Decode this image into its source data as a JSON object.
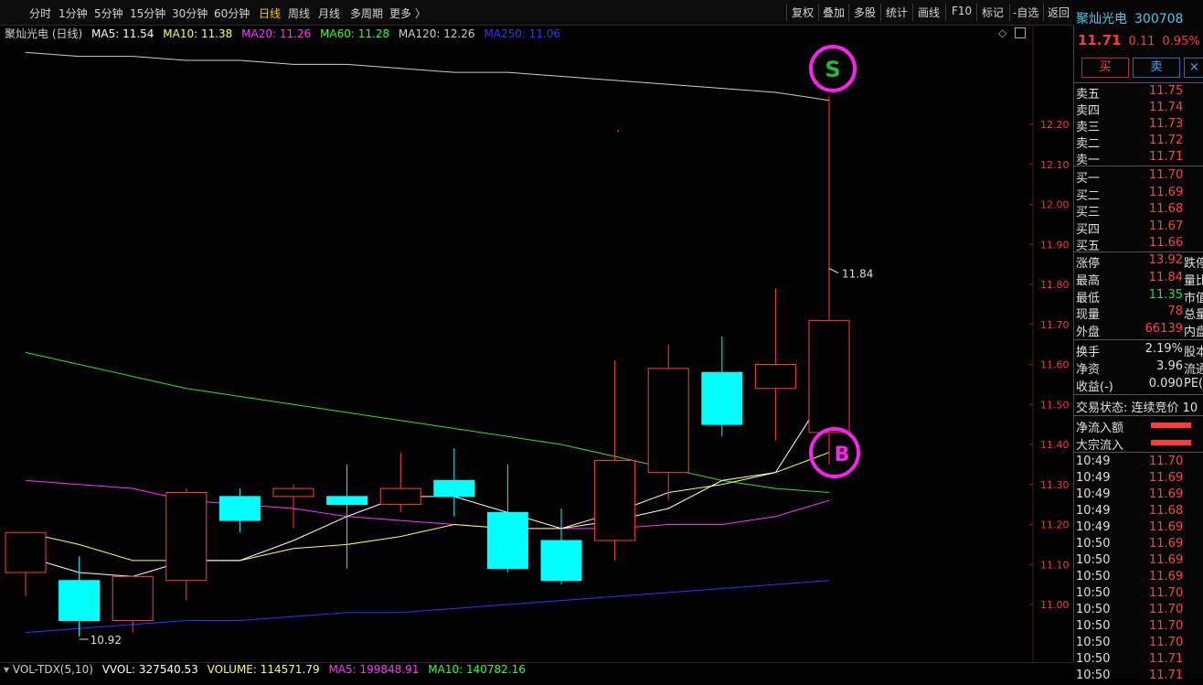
{
  "toolbar": {
    "periods": [
      "分时",
      "1分钟",
      "5分钟",
      "15分钟",
      "30分钟",
      "60分钟",
      "日线",
      "周线",
      "月线",
      "多周期",
      "更多 〉"
    ],
    "active_period": "日线",
    "right_buttons": [
      "复权",
      "叠加",
      "多股",
      "统计",
      "画线",
      "F10",
      "标记",
      "-自选",
      "返回"
    ]
  },
  "legend": {
    "title": "聚灿光电 (日线)",
    "items": [
      {
        "text": "MA5: 11.54",
        "color": "#ffffff"
      },
      {
        "text": "MA10: 11.38",
        "color": "#ffff55"
      },
      {
        "text": "MA20: 11.26",
        "color": "#ff33ff"
      },
      {
        "text": "MA60: 11.28",
        "color": "#33ff33"
      },
      {
        "text": "MA120: 12.26",
        "color": "#d0d0d0"
      },
      {
        "text": "MA250: 11.06",
        "color": "#3333ff"
      }
    ]
  },
  "chart_data": {
    "type": "candlestick",
    "y_ticks": [
      "12.20",
      "12.10",
      "12.00",
      "11.90",
      "11.80",
      "11.70",
      "11.60",
      "11.50",
      "11.40",
      "11.30",
      "11.20",
      "11.10",
      "11.00"
    ],
    "ylim": [
      10.9,
      12.3
    ],
    "candles": [
      {
        "o": 11.08,
        "c": 11.18,
        "h": 11.18,
        "l": 11.02
      },
      {
        "o": 11.06,
        "c": 10.96,
        "h": 11.12,
        "l": 10.92
      },
      {
        "o": 10.96,
        "c": 11.07,
        "h": 11.07,
        "l": 10.93
      },
      {
        "o": 11.06,
        "c": 11.28,
        "h": 11.29,
        "l": 11.01
      },
      {
        "o": 11.27,
        "c": 11.21,
        "h": 11.29,
        "l": 11.18
      },
      {
        "o": 11.27,
        "c": 11.29,
        "h": 11.3,
        "l": 11.19
      },
      {
        "o": 11.27,
        "c": 11.25,
        "h": 11.35,
        "l": 11.09
      },
      {
        "o": 11.25,
        "c": 11.29,
        "h": 11.38,
        "l": 11.23
      },
      {
        "o": 11.31,
        "c": 11.27,
        "h": 11.39,
        "l": 11.22
      },
      {
        "o": 11.23,
        "c": 11.09,
        "h": 11.35,
        "l": 11.08
      },
      {
        "o": 11.16,
        "c": 11.06,
        "h": 11.24,
        "l": 11.05
      },
      {
        "o": 11.16,
        "c": 11.36,
        "h": 11.61,
        "l": 11.11
      },
      {
        "o": 11.33,
        "c": 11.59,
        "h": 11.65,
        "l": 11.26
      },
      {
        "o": 11.58,
        "c": 11.45,
        "h": 11.67,
        "l": 11.42
      },
      {
        "o": 11.54,
        "c": 11.6,
        "h": 11.79,
        "l": 11.41
      },
      {
        "o": 11.43,
        "c": 11.71,
        "h": 12.27,
        "l": 11.35
      }
    ],
    "ma5": [
      11.12,
      11.08,
      11.07,
      11.11,
      11.11,
      11.16,
      11.22,
      11.27,
      11.27,
      11.23,
      11.19,
      11.21,
      11.24,
      11.31,
      11.33,
      11.54
    ],
    "ma10": [
      11.18,
      11.15,
      11.11,
      11.11,
      11.11,
      11.14,
      11.15,
      11.17,
      11.2,
      11.19,
      11.19,
      11.23,
      11.28,
      11.3,
      11.33,
      11.38
    ],
    "ma20": [
      11.31,
      11.3,
      11.29,
      11.26,
      11.25,
      11.24,
      11.22,
      11.21,
      11.2,
      11.19,
      11.19,
      11.19,
      11.2,
      11.2,
      11.22,
      11.26
    ],
    "ma60": [
      11.63,
      11.6,
      11.57,
      11.54,
      11.52,
      11.5,
      11.48,
      11.46,
      11.44,
      11.42,
      11.4,
      11.37,
      11.34,
      11.31,
      11.29,
      11.28
    ],
    "ma120": [
      12.38,
      12.37,
      12.37,
      12.36,
      12.36,
      12.35,
      12.35,
      12.34,
      12.33,
      12.33,
      12.32,
      12.31,
      12.3,
      12.29,
      12.28,
      12.26
    ],
    "ma250": [
      10.93,
      10.94,
      10.95,
      10.96,
      10.96,
      10.97,
      10.98,
      10.98,
      10.99,
      11.0,
      11.01,
      11.02,
      11.03,
      11.04,
      11.05,
      11.06
    ],
    "annotations": {
      "high_label": "11.84",
      "low_label": "10.92",
      "sell_marker": "S",
      "buy_marker": "B"
    }
  },
  "volume_bar": {
    "title": "VOL-TDX(5,10)",
    "items": [
      {
        "text": "VVOL: 327540.53",
        "color": "#ffffff"
      },
      {
        "text": "VOLUME: 114571.79",
        "color": "#ffff55"
      },
      {
        "text": "MA5: 199848.91",
        "color": "#ff33ff"
      },
      {
        "text": "MA10: 140782.16",
        "color": "#33ff33"
      }
    ]
  },
  "stock": {
    "name": "聚灿光电",
    "code": "300708",
    "price": "11.71",
    "change": "0.11",
    "pct": "0.95%"
  },
  "trade_buttons": {
    "buy": "买",
    "sell": "卖"
  },
  "asks": [
    {
      "label": "卖五",
      "price": "11.75"
    },
    {
      "label": "卖四",
      "price": "11.74"
    },
    {
      "label": "卖三",
      "price": "11.73"
    },
    {
      "label": "卖二",
      "price": "11.72"
    },
    {
      "label": "卖一",
      "price": "11.71"
    }
  ],
  "bids": [
    {
      "label": "买一",
      "price": "11.70"
    },
    {
      "label": "买二",
      "price": "11.69"
    },
    {
      "label": "买三",
      "price": "11.68"
    },
    {
      "label": "买四",
      "price": "11.67"
    },
    {
      "label": "买五",
      "price": "11.66"
    }
  ],
  "stats": [
    {
      "label": "涨停",
      "value": "13.92",
      "value_color": "#ff4444",
      "extra": "跌停"
    },
    {
      "label": "最高",
      "value": "11.84",
      "value_color": "#ff4444",
      "extra": "量比"
    },
    {
      "label": "最低",
      "value": "11.35",
      "value_color": "#33dd33",
      "extra": "市值"
    },
    {
      "label": "现量",
      "value": "78",
      "value_color": "#ff4444",
      "extra": "总量"
    },
    {
      "label": "外盘",
      "value": "66139",
      "value_color": "#ff4444",
      "extra": "内盘"
    }
  ],
  "stats2": [
    {
      "label": "换手",
      "value": "2.19%",
      "extra": "股本"
    },
    {
      "label": "净资",
      "value": "3.96",
      "extra": "流通"
    },
    {
      "label": "收益(-)",
      "value": "0.090",
      "extra": "PE("
    }
  ],
  "trade_status": "交易状态: 连续竞价 10",
  "flows": [
    {
      "label": "净流入额"
    },
    {
      "label": "大宗流入"
    }
  ],
  "ticks": [
    {
      "time": "10:49",
      "price": "11.70"
    },
    {
      "time": "10:49",
      "price": "11.69"
    },
    {
      "time": "10:49",
      "price": "11.69"
    },
    {
      "time": "10:49",
      "price": "11.68"
    },
    {
      "time": "10:49",
      "price": "11.69"
    },
    {
      "time": "10:50",
      "price": "11.69"
    },
    {
      "time": "10:50",
      "price": "11.69"
    },
    {
      "time": "10:50",
      "price": "11.69"
    },
    {
      "time": "10:50",
      "price": "11.70"
    },
    {
      "time": "10:50",
      "price": "11.70"
    },
    {
      "time": "10:50",
      "price": "11.70"
    },
    {
      "time": "10:50",
      "price": "11.70"
    },
    {
      "time": "10:50",
      "price": "11.71"
    },
    {
      "time": "10:50",
      "price": "11.71"
    }
  ],
  "colors": {
    "up": "#ff3c3c",
    "down": "#00ffff",
    "marker": "#ff22ee",
    "sell_text": "#22bb33"
  }
}
